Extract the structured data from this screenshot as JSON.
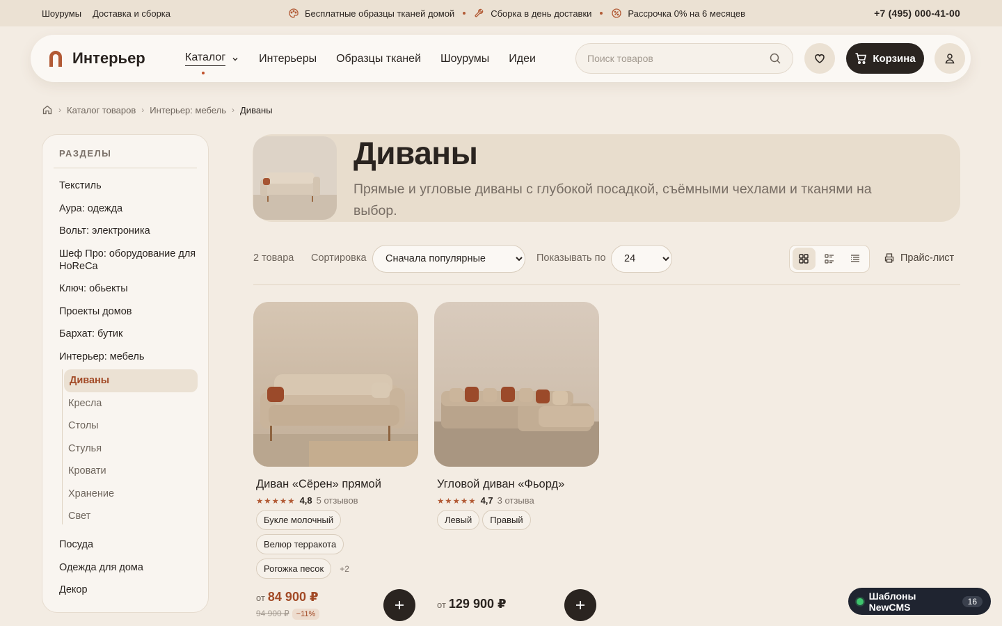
{
  "topbar": {
    "links": [
      "Шоурумы",
      "Доставка и сборка"
    ],
    "promos": [
      {
        "icon": "palette-icon",
        "text": "Бесплатные образцы тканей домой"
      },
      {
        "icon": "wrench-icon",
        "text": "Сборка в день доставки"
      },
      {
        "icon": "percent-icon",
        "text": "Рассрочка 0% на 6 месяцев"
      }
    ],
    "phone": "+7 (495) 000-41-00"
  },
  "header": {
    "logo_text": "Интерьер",
    "nav": [
      "Каталог",
      "Интерьеры",
      "Образцы тканей",
      "Шоурумы",
      "Идеи"
    ],
    "search_placeholder": "Поиск товаров",
    "cart_label": "Корзина"
  },
  "breadcrumb": [
    "Каталог товаров",
    "Интерьер: мебель",
    "Диваны"
  ],
  "sidebar": {
    "title": "РАЗДЕЛЫ",
    "items": [
      "Текстиль",
      "Аура: одежда",
      "Вольт: электроника",
      "Шеф Про: оборудование для HoReCa",
      "Ключ: обьекты",
      "Проекты домов",
      "Бархат: бутик",
      "Интерьер: мебель"
    ],
    "sub_items": [
      "Диваны",
      "Кресла",
      "Столы",
      "Стулья",
      "Кровати",
      "Хранение",
      "Свет"
    ],
    "active_sub": "Диваны",
    "items_after": [
      "Посуда",
      "Одежда для дома",
      "Декор"
    ]
  },
  "hero": {
    "title": "Диваны",
    "description": "Прямые и угловые диваны с глубокой посадкой, съёмными чехлами и тканями на выбор."
  },
  "toolbar": {
    "count": "2 товара",
    "sort_label": "Сортировка",
    "sort_value": "Сначала популярные",
    "show_label": "Показывать по",
    "show_value": "24",
    "price_list": "Прайс-лист"
  },
  "products": [
    {
      "name": "Диван «Сёрен» прямой",
      "stars": "★★★★★",
      "score": "4,8",
      "reviews": "5 отзывов",
      "chips": [
        "Букле молочный",
        "Велюр терракота",
        "Рогожка песок"
      ],
      "more": "+2",
      "price_from": "от",
      "price": "84 900 ₽",
      "old_price": "94 900 ₽",
      "discount": "−11%"
    },
    {
      "name": "Угловой диван «Фьорд»",
      "stars": "★★★★★",
      "score": "4,7",
      "reviews": "3 отзыва",
      "chips": [
        "Левый",
        "Правый"
      ],
      "price_from": "от",
      "price": "129 900 ₽"
    }
  ],
  "badge": {
    "label": "Шаблоны NewCMS",
    "count": "16"
  },
  "colors": {
    "accent": "#b25a35",
    "dark": "#2a2420",
    "background": "#f3ece3"
  }
}
